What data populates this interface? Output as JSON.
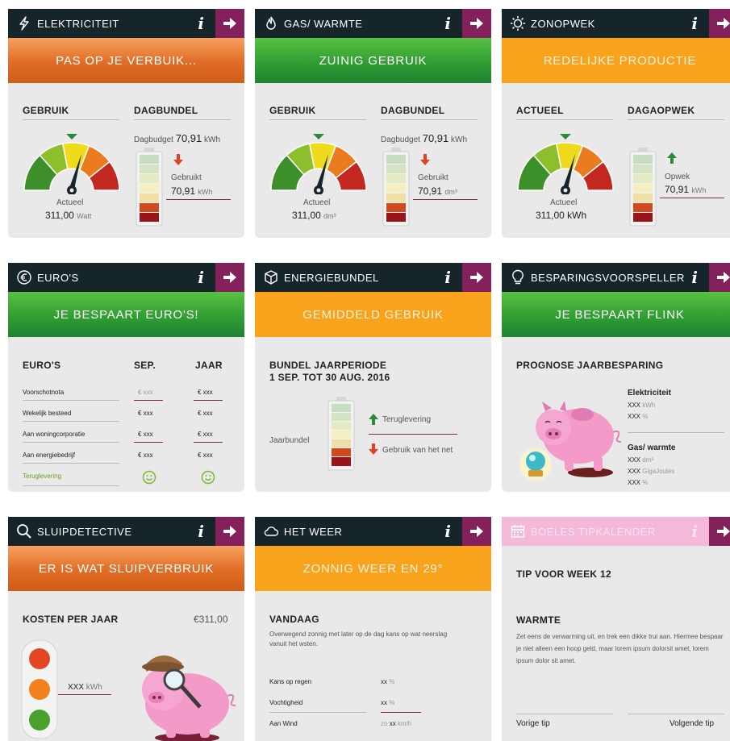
{
  "cards": {
    "elektriciteit": {
      "title": "ELEKTRICITEIT",
      "banner": "PAS OP JE VERBUIK...",
      "col1": "GEBRUIK",
      "col2": "DAGBUNDEL",
      "budget_label": "Dagbudget",
      "budget_value": "70,91",
      "budget_unit": "kWh",
      "used_label": "Gebruikt",
      "used_value": "70,91",
      "used_unit": "kWh",
      "actueel_label": "Actueel",
      "actueel_value": "311,00",
      "actueel_unit": "Watt"
    },
    "gas": {
      "title": "GAS/ WARMTE",
      "banner": "ZUINIG GEBRUIK",
      "col1": "GEBRUIK",
      "col2": "DAGBUNDEL",
      "budget_label": "Dagbudget",
      "budget_value": "70,91",
      "budget_unit": "kWh",
      "used_label": "Gebruikt",
      "used_value": "70,91",
      "used_unit": "dm³",
      "actueel_label": "Actueel",
      "actueel_value": "311,00",
      "actueel_unit": "dm³"
    },
    "zonopwek": {
      "title": "ZONOPWEK",
      "banner": "REDELIJKE PRODUCTIE",
      "col1": "ACTUEEL",
      "col2": "DAGAOPWEK",
      "used_label": "Opwek",
      "used_value": "70,91",
      "used_unit": "kWh",
      "actueel_label": "Actueel",
      "actueel_value": "311,00",
      "actueel_unit": "kWh"
    },
    "euros": {
      "title": "EURO'S",
      "banner": "JE BESPAART EURO'S!",
      "col1": "EURO'S",
      "col2": "SEP.",
      "col3": "JAAR",
      "rows": [
        {
          "label": "Voorschotnota",
          "sep": "€ xxx",
          "jaar": "€ xxx"
        },
        {
          "label": "Wekelijk besteed",
          "sep": "€ xxx",
          "jaar": "€ xxx"
        },
        {
          "label": "Aan woningcorporatie",
          "sep": "€ xxx",
          "jaar": "€ xxx"
        },
        {
          "label": "Aan energiebedrijf",
          "sep": "€ xxx",
          "jaar": "€ xxx"
        }
      ],
      "teruglevering": "Teruglevering"
    },
    "energiebundel": {
      "title": "ENERGIEBUNDEL",
      "banner": "GEMIDDELD GEBRUIK",
      "heading1": "BUNDEL JAARPERIODE",
      "heading2": "1 SEP. TOT 30 AUG. 2016",
      "jaarbundel": "Jaarbundel",
      "teruglevering": "Teruglevering",
      "gebruik_net": "Gebruik van het net"
    },
    "besparing": {
      "title": "BESPARINGSVOORSPELLER",
      "banner": "JE BESPAART FLINK",
      "heading": "PROGNOSE JAARBESPARING",
      "elek_title": "Elektriciteit",
      "elek_line1_val": "XXX",
      "elek_line1_unit": "kWh",
      "elek_line2_val": "XXX",
      "elek_line2_unit": "%",
      "gas_title": "Gas/ warmte",
      "gas_line1_val": "XXX",
      "gas_line1_unit": "dm³",
      "gas_line2_val": "XXX",
      "gas_line2_unit": "GigaJoules",
      "gas_line3_val": "XXX",
      "gas_line3_unit": "%"
    },
    "sluip": {
      "title": "SLUIPDETECTIVE",
      "banner": "ER IS WAT SLUIPVERBRUIK",
      "heading": "KOSTEN PER JAAR",
      "cost": "€311,00",
      "kwh_value": "XXX",
      "kwh_unit": "kWh"
    },
    "weer": {
      "title": "HET WEER",
      "banner": "ZONNIG WEER EN 29°",
      "heading": "VANDAAG",
      "desc": "Overwegend zonnig met later op de dag kans op wat neerslag vanuit het wsten.",
      "rows": [
        {
          "label": "Kans op regen",
          "pre": "",
          "val": "xx",
          "unit": "%"
        },
        {
          "label": "Vochtigheid",
          "pre": "",
          "val": "xx",
          "unit": "%"
        },
        {
          "label": "Aan Wind",
          "pre": "zo",
          "val": "xx",
          "unit": "km/h"
        }
      ]
    },
    "tip": {
      "title": "BOELES TIPKALENDER",
      "heading": "TIP VOOR WEEK 12",
      "subheading": "WARMTE",
      "text": "Zet eens de verwarming uit, en trek een dikke trui aan. Hiermee bespaar je niet alleen een hoop geld, maar lorem ipsum dolorsit amet, lorem ipsum dolor sit amet.",
      "prev": "Vorige tip",
      "next": "Volgende tip"
    }
  }
}
